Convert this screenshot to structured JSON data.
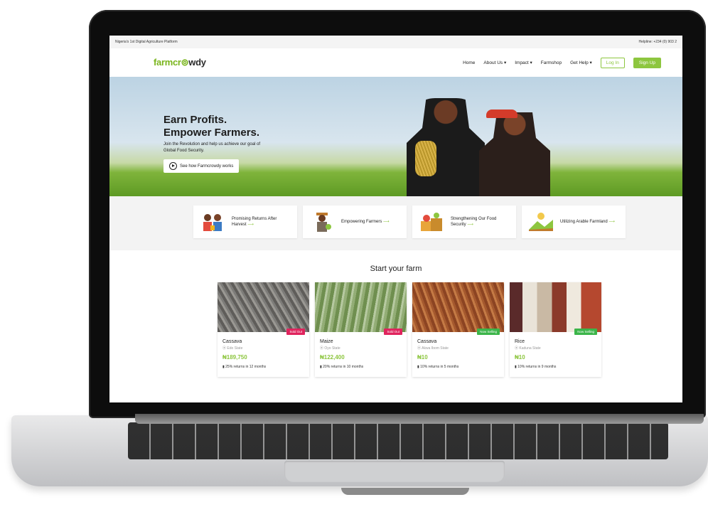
{
  "topbar": {
    "tagline": "Nigeria's 1st Digital Agriculture Platform",
    "helpline": "Helpline: +234 (0) 903 2"
  },
  "logo": {
    "part1": "farmcr",
    "part2": "wdy"
  },
  "nav": [
    {
      "label": "Home"
    },
    {
      "label": "About Us ▾"
    },
    {
      "label": "Impact ▾"
    },
    {
      "label": "Farmshop"
    },
    {
      "label": "Get Help ▾"
    }
  ],
  "auth": {
    "login": "Log In",
    "signup": "Sign Up"
  },
  "hero": {
    "line1": "Earn Profits.",
    "line2": "Empower Farmers.",
    "subtitle": "Join the Revolution and help us achieve our goal of Global Food Security.",
    "cta": "See how Farmcrowdy works"
  },
  "features": [
    {
      "text": "Promising Returns After Harvest",
      "icon": "returns-icon"
    },
    {
      "text": "Empowering Farmers",
      "icon": "farmer-icon"
    },
    {
      "text": "Strengthening Our Food Security",
      "icon": "produce-icon"
    },
    {
      "text": "Utilizing Arable Farmland",
      "icon": "farmland-icon"
    }
  ],
  "section_title": "Start your farm",
  "cards": [
    {
      "name": "Cassava",
      "location": "Edo State",
      "price": "₦189,750",
      "returns": "25% returns in 12 months",
      "badge": "Sold Out",
      "badge_color": "#e0245e",
      "img_color": "#7d7c79"
    },
    {
      "name": "Maize",
      "location": "Oyo State",
      "price": "₦122,400",
      "returns": "20% returns in 10 months",
      "badge": "Sold Out",
      "badge_color": "#e0245e",
      "img_color": "#7b9a5a"
    },
    {
      "name": "Cassava",
      "location": "Akwa Ibom State",
      "price": "₦10",
      "returns": "10% returns in 5 months",
      "badge": "Now Selling",
      "badge_color": "#3cb54a",
      "img_color": "#a5592e"
    },
    {
      "name": "Rice",
      "location": "Kaduna State",
      "price": "₦10",
      "returns": "10% returns in 9 months",
      "badge": "Now Selling",
      "badge_color": "#3cb54a",
      "img_color": "#c9b9a4"
    }
  ],
  "colors": {
    "brand": "#8dc63f",
    "sold_out": "#e0245e",
    "now_selling": "#3cb54a"
  }
}
